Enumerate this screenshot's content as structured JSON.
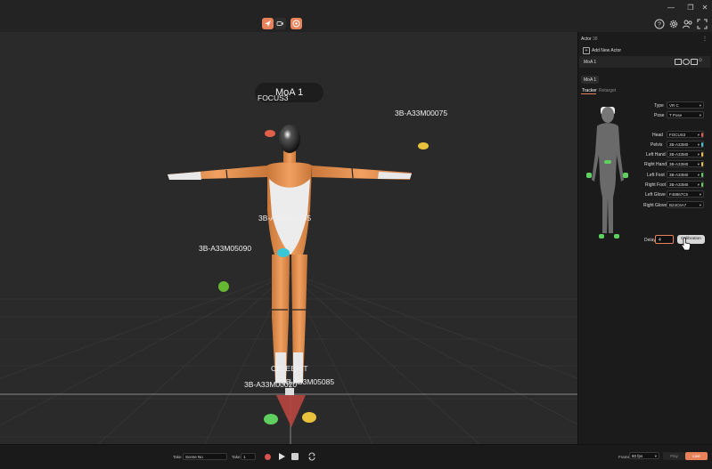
{
  "toolbar": {
    "icons": [
      "send-icon",
      "camera-icon",
      "target-icon"
    ],
    "right_icons": [
      "help-icon",
      "settings-icon",
      "user-group-icon",
      "fullscreen-icon"
    ],
    "accent": "#e8825a"
  },
  "viewport": {
    "title": "MoA 1",
    "labels": {
      "head": "FOCUS3",
      "tracker_1": "3B-A33M00075",
      "tracker_2": "3B-A33M03755",
      "tracker_3": "3B-A33M05090",
      "tracker_4": "3B-A33M00020",
      "tracker_5": "3B-A33M05085",
      "overlap": "CELEBRIT"
    }
  },
  "panel": {
    "header": "Actor",
    "header_sub": "38",
    "add_actor": "Add New Actor",
    "actor_name": "MoA 1",
    "section_title": "MoA 1",
    "tabs": [
      "Tracker",
      "Retarget"
    ],
    "active_tab": "Tracker",
    "fields": [
      {
        "label": "Type",
        "value": "VR C",
        "color": ""
      },
      {
        "label": "Pose",
        "value": "T Pose",
        "color": ""
      },
      {
        "label": "Head",
        "value": "FOCUS3",
        "color": "#e85a4a"
      },
      {
        "label": "Pelvis",
        "value": "3B-A33M0",
        "color": "#3ac7d8"
      },
      {
        "label": "Left Hand",
        "value": "3B-A33M0",
        "color": "#e8c23a"
      },
      {
        "label": "Right Hand",
        "value": "3B-A33M0",
        "color": "#e8c23a"
      },
      {
        "label": "Left Foot",
        "value": "3B-A33M0",
        "color": "#5fd05f"
      },
      {
        "label": "Right Foot",
        "value": "3B-A33M0",
        "color": "#5fd05f"
      },
      {
        "label": "Left Glove",
        "value": "F48867C5",
        "color": ""
      },
      {
        "label": "Right Glove",
        "value": "B24C6A7",
        "color": ""
      }
    ],
    "delay_label": "Delay",
    "delay_value": "4",
    "calibration": "Calibration"
  },
  "bottom": {
    "take_label": "Take",
    "scene_value": "Scene No",
    "take_value": "1",
    "frame_label": "Frame",
    "fps_value": "60 fps",
    "play_label": "Play",
    "live_label": "Live"
  }
}
